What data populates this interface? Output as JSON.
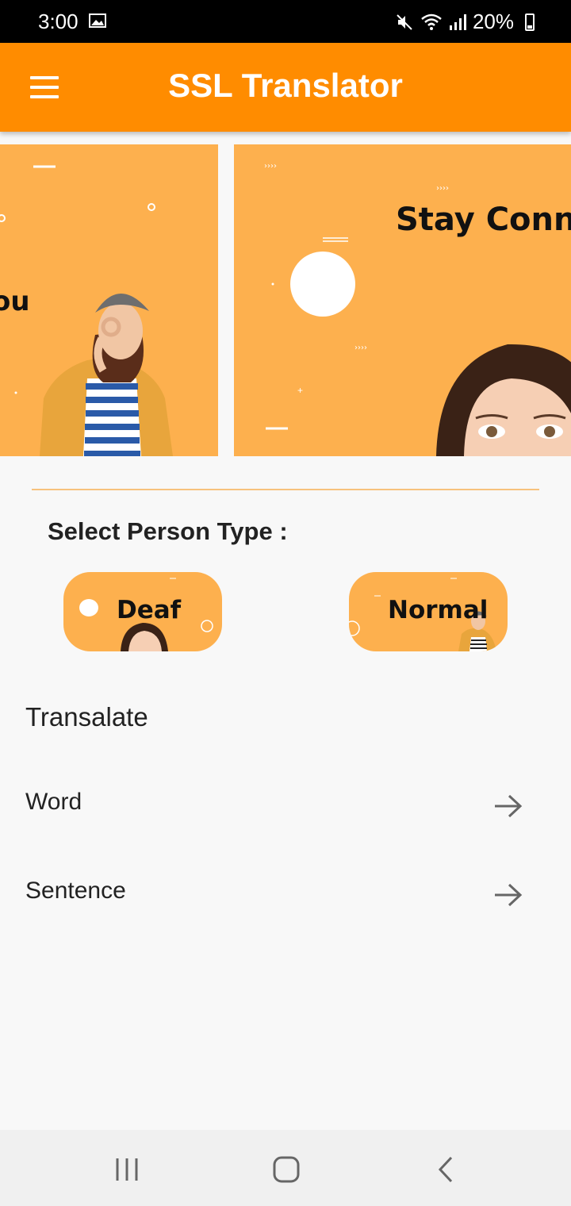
{
  "status_bar": {
    "time": "3:00",
    "battery": "20%",
    "icons": [
      "image-icon",
      "mute-icon",
      "wifi-icon",
      "signal-icon",
      "battery-icon"
    ]
  },
  "app_bar": {
    "title": "SSL Translator",
    "background": "#ff8c00",
    "menu_icon": "hamburger-menu-icon"
  },
  "carousel": {
    "banners": [
      {
        "text": "ou"
      },
      {
        "text": "Stay Conne"
      }
    ],
    "background": "#fdb04e"
  },
  "select_person": {
    "label": "Select Person Type :",
    "options": [
      {
        "label": "Deaf"
      },
      {
        "label": "Normal"
      }
    ]
  },
  "translate": {
    "title": "Transalate",
    "items": [
      {
        "label": "Word",
        "icon": "arrow-right-icon"
      },
      {
        "label": "Sentence",
        "icon": "arrow-right-icon"
      }
    ]
  },
  "nav_bar": {
    "icons": [
      "recent-apps-icon",
      "home-icon",
      "back-icon"
    ]
  }
}
